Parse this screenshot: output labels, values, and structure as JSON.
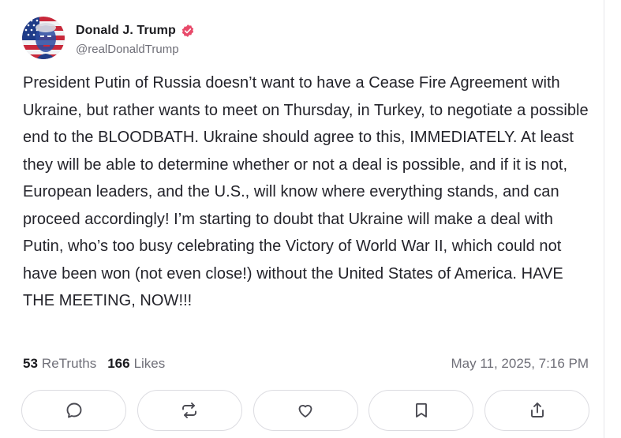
{
  "post": {
    "author": {
      "display_name": "Donald J. Trump",
      "handle": "@realDonaldTrump",
      "verified": true,
      "avatar_icon": "avatar-portrait",
      "verified_color": "#e84a6a"
    },
    "paragraphs": [
      "President Putin of Russia doesn’t want to have a Cease Fire Agreement with Ukraine, but rather wants to meet on Thursday, in Turkey, to negotiate a possible end to the BLOODBATH. Ukraine should agree to this, IMMEDIATELY. At least they will be able to determine whether or not a deal is possible, and if it is not, European leaders, and the U.S., will know where everything stands, and can proceed accordingly! I’m starting to doubt that Ukraine will make a deal with Putin, who’s too busy celebrating the Victory of World War II, which could not have been won (not even close!) without the United States of America. HAVE THE MEETING, NOW!!!"
    ],
    "stats": {
      "retruths_count": "53",
      "retruths_label": "ReTruths",
      "likes_count": "166",
      "likes_label": "Likes"
    },
    "timestamp": "May 11, 2025, 7:16 PM",
    "actions": [
      {
        "name": "reply-button",
        "icon": "chat-bubble-icon"
      },
      {
        "name": "retruth-button",
        "icon": "repost-icon"
      },
      {
        "name": "like-button",
        "icon": "heart-icon"
      },
      {
        "name": "bookmark-button",
        "icon": "bookmark-icon"
      },
      {
        "name": "share-button",
        "icon": "share-icon"
      }
    ],
    "icon_color": "#4a4a52"
  }
}
